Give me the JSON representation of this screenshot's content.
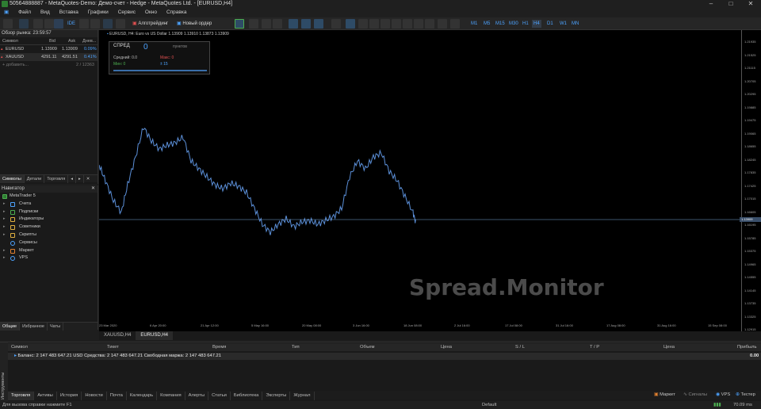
{
  "window": {
    "title": "50564888887 - MetaQuotes-Demo: Демо-счет - Hedge - MetaQuotes Ltd. - [EURUSD,H4]",
    "controls": [
      "–",
      "□",
      "✕"
    ]
  },
  "menu": [
    "Файл",
    "Вид",
    "Вставка",
    "Графики",
    "Сервис",
    "Окно",
    "Справка"
  ],
  "toolbar": {
    "algotrading_label": "Алготрейдинг",
    "new_order_label": "Новый ордер",
    "ide_label": "IDE",
    "timeframes": [
      "M1",
      "M5",
      "M15",
      "M30",
      "H1",
      "H4",
      "D1",
      "W1",
      "MN"
    ],
    "active_timeframe": "H4"
  },
  "market_watch": {
    "title": "Обзор рынка: 23:59:57",
    "columns": [
      "Символ",
      "Bid",
      "Ask",
      "Днев..."
    ],
    "rows": [
      {
        "symbol": "EURUSD",
        "bid": "1.13909",
        "ask": "1.13909",
        "change": "0.09%"
      },
      {
        "symbol": "XAUUSD",
        "bid": "4291.11",
        "ask": "4291.51",
        "change": "0.41%"
      }
    ],
    "add_label": "+ добавить...",
    "count": "2 / 12363",
    "tabs": [
      "Символы",
      "Детали",
      "Торговля"
    ]
  },
  "navigator": {
    "title": "Навигатор",
    "items": [
      "MetaTrader 5",
      "Счета",
      "Подписки",
      "Индикаторы",
      "Советники",
      "Скрипты",
      "Сервисы",
      "Маркет",
      "VPS"
    ],
    "tabs": [
      "Общие",
      "Избранное",
      "Чаты"
    ]
  },
  "chart": {
    "header": "EURUSD, H4: Euro vs US Dollar  1.13909 1.13910 1.13873 1.13909",
    "current_price": "1.13909",
    "price_ticks": [
      "1.21935",
      "1.21525",
      "1.21115",
      "1.20705",
      "1.20295",
      "1.19885",
      "1.19475",
      "1.19065",
      "1.18655",
      "1.18245",
      "1.17835",
      "1.17425",
      "1.17015",
      "1.16605",
      "1.16195",
      "1.15785",
      "1.15375",
      "1.14965",
      "1.14555",
      "1.14145",
      "1.13735",
      "1.13325",
      "1.12915",
      "1.12505",
      "1.12095",
      "1.11685",
      "1.11275",
      "1.10865",
      "1.10455",
      "1.10045"
    ],
    "time_ticks": [
      "23 Mar 2020",
      "6 Apr 20:00",
      "21 Apr 12:00",
      "5 May 16:00",
      "20 May 08:00",
      "3 Jun 16:00",
      "18 Jun 08:00",
      "2 Jul 16:00",
      "17 Jul 08:00",
      "31 Jul 16:00",
      "17 Aug 08:00",
      "31 Aug 16:00",
      "15 Sep 08:00",
      "30 Sep 16:00"
    ],
    "line_color": "#5b8fd8",
    "watermark": "Spread.Monitor",
    "tabs": [
      "XAUUSD,H4",
      "EURUSD,H4"
    ],
    "active_tab": "EURUSD,H4"
  },
  "spread_panel": {
    "title": "СПРЕД",
    "value": "0",
    "unit": "пунктов",
    "avg_label": "Средний: 0.0",
    "max_label": "Макс: 0",
    "min_label": "Мин: 0",
    "count_label": "± 15"
  },
  "terminal": {
    "columns": [
      "Символ",
      "Тикет",
      "Время",
      "Тип",
      "Объем",
      "Цена",
      "S / L",
      "T / P",
      "Цена",
      "Прибыль"
    ],
    "balance_row": "Баланс: 2 147 483 647.21 USD  Средства: 2 147 483 647.21  Свободная маржа: 2 147 483 647.21",
    "profit": "0.00",
    "side_label": "Инструменты",
    "tabs": [
      "Торговля",
      "Активы",
      "История",
      "Новости",
      "Почта",
      "Календарь",
      "Компания",
      "Алерты",
      "Статьи",
      "Библиотека",
      "Эксперты",
      "Журнал"
    ],
    "right_items": [
      "Маркет",
      "Сигналы",
      "VPS",
      "Тестер"
    ]
  },
  "status": {
    "help": "Для вызова справки нажмите F1",
    "profile": "Default",
    "ping": "70.09 ms"
  }
}
